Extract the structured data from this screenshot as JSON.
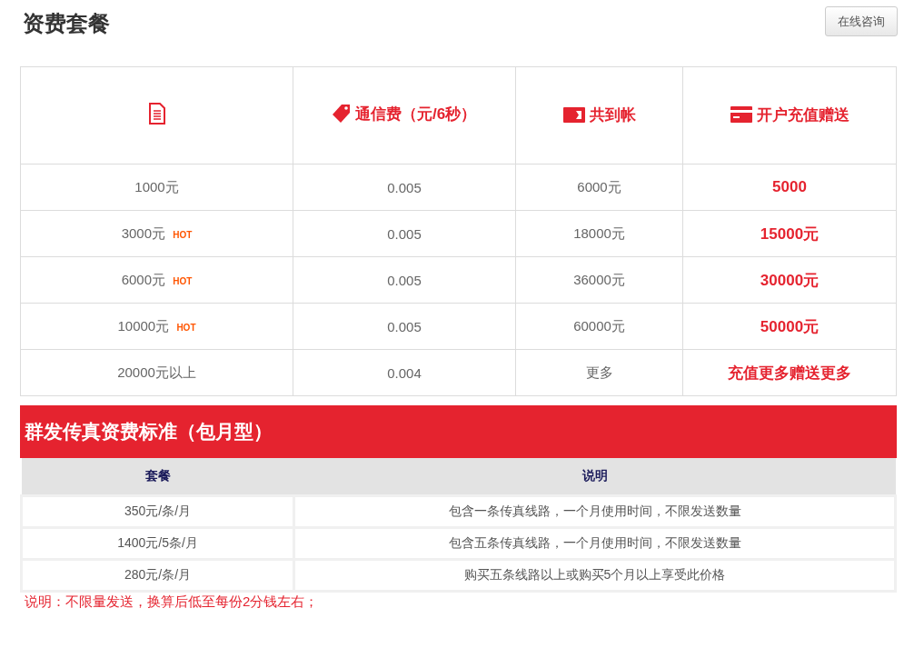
{
  "title": "资费套餐",
  "consult_button": "在线咨询",
  "price_table": {
    "columns": [
      "通信费（元/6秒）",
      "共到帐",
      "开户充值赠送"
    ],
    "rows": [
      {
        "amount": "1000元",
        "hot": false,
        "rate": "0.005",
        "credited": "6000元",
        "bonus": "5000"
      },
      {
        "amount": "3000元",
        "hot": true,
        "badge": "HOT",
        "rate": "0.005",
        "credited": "18000元",
        "bonus": "15000元"
      },
      {
        "amount": "6000元",
        "hot": true,
        "badge": "HOT",
        "rate": "0.005",
        "credited": "36000元",
        "bonus": "30000元"
      },
      {
        "amount": "10000元",
        "hot": true,
        "badge": "HOT",
        "rate": "0.005",
        "credited": "60000元",
        "bonus": "50000元"
      },
      {
        "amount": "20000元以上",
        "hot": false,
        "rate": "0.004",
        "credited": "更多",
        "bonus": "充值更多赠送更多"
      }
    ]
  },
  "fax_section": {
    "title": "群发传真资费标准（包月型）",
    "columns": [
      "套餐",
      "说明"
    ],
    "rows": [
      {
        "plan": "350元/条/月",
        "description": "包含一条传真线路，一个月使用时间，不限发送数量"
      },
      {
        "plan": "1400元/5条/月",
        "description": "包含五条传真线路，一个月使用时间，不限发送数量"
      },
      {
        "plan": "280元/条/月",
        "description": "购买五条线路以上或购买5个月以上享受此价格"
      }
    ]
  },
  "note": "说明：不限量发送，换算后低至每份2分钱左右；"
}
